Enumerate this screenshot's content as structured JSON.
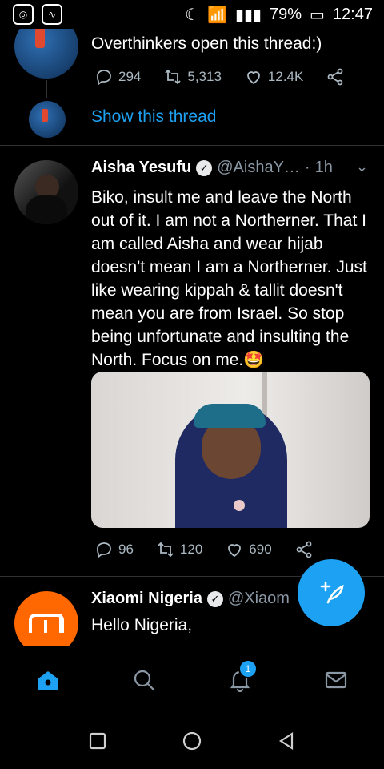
{
  "status": {
    "battery": "79%",
    "time": "12:47"
  },
  "tweets": [
    {
      "text": "Overthinkers open this thread:)",
      "reply_count": "294",
      "retweet_count": "5,313",
      "like_count": "12.4K",
      "show_thread": "Show this thread"
    },
    {
      "name": "Aisha Yesufu",
      "handle": "@AishaY…",
      "dot": "·",
      "time": "1h",
      "text": "Biko, insult me and leave the North out of it. I am not a Northerner. That I am called Aisha and wear hijab doesn't mean I am a Northerner. Just like wearing kippah & tallit doesn't mean you are from Israel. So stop being unfortunate and insulting the North. Focus on me.🤩",
      "reply_count": "96",
      "retweet_count": "120",
      "like_count": "690"
    },
    {
      "name": "Xiaomi Nigeria",
      "handle": "@Xiaom",
      "text": "Hello Nigeria,"
    }
  ],
  "nav": {
    "notification_count": "1"
  },
  "colors": {
    "accent": "#1da1f2",
    "background": "#000000",
    "muted": "#8b98a5"
  }
}
